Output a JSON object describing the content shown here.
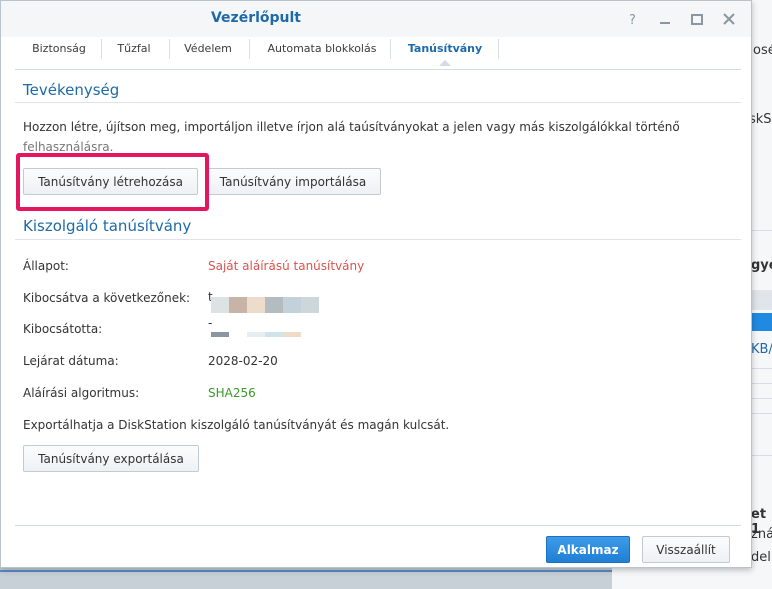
{
  "window": {
    "title": "Vezérlőpult",
    "help_icon": "question-mark-icon",
    "minimize_icon": "minimize-icon",
    "maximize_icon": "maximize-icon",
    "close_icon": "close-icon"
  },
  "tabs": [
    {
      "label": "Biztonság"
    },
    {
      "label": "Tűzfal"
    },
    {
      "label": "Védelem"
    },
    {
      "label": "Automata blokkolás"
    },
    {
      "label": "Tanúsítvány",
      "active": true
    }
  ],
  "activity": {
    "title": "Tevékenység",
    "description_line1": "Hozzon létre, újítson meg, importáljon illetve írjon alá taúsítványokat a jelen vagy más kiszolgálókkal történő",
    "description_line2": "felhasználásra.",
    "create_button": "Tanúsítvány létrehozása",
    "import_button": "Tanúsítvány importálása"
  },
  "server_cert": {
    "title": "Kiszolgáló tanúsítvány",
    "status_label": "Állapot:",
    "status_value": "Saját aláírású tanúsítvány",
    "issued_to_label": "Kibocsátva a következőnek:",
    "issued_to_value": "t",
    "issued_by_label": "Kibocsátotta:",
    "issued_by_value": "-",
    "expiry_label": "Lejárat dátuma:",
    "expiry_value": "2028-02-20",
    "algorithm_label": "Aláírási algoritmus:",
    "algorithm_value": "SHA256",
    "export_note": "Exportálhatja a DiskStation kiszolgáló tanúsítványát és magán kulcsát.",
    "export_button": "Tanúsítvány exportálása"
  },
  "footer": {
    "apply_button": "Alkalmaz",
    "reset_button": "Visszaállít"
  },
  "background": {
    "fragments": [
      "osé",
      "skS",
      "gye",
      "KB/",
      "et 1",
      "zná",
      "delk"
    ]
  },
  "colors": {
    "accent": "#1e6aa8",
    "status_red": "#d9534f",
    "algorithm_green": "#3a9a2a",
    "highlight": "#e4165f"
  }
}
